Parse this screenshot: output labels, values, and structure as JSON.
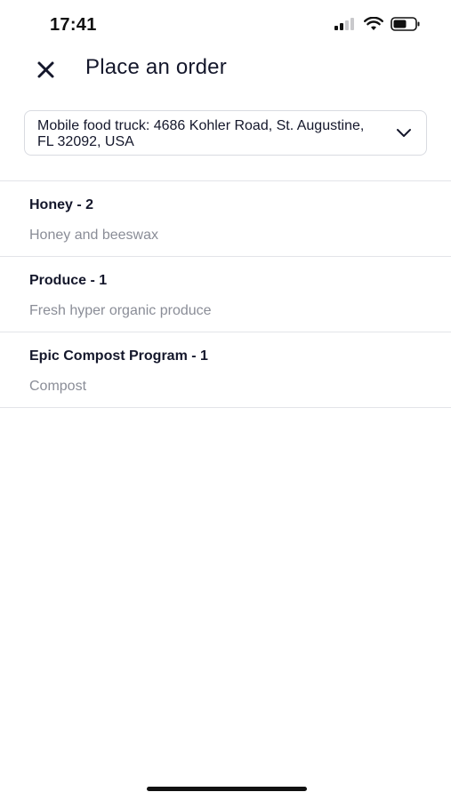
{
  "status_bar": {
    "time": "17:41",
    "icons": [
      "cellular-signal-icon",
      "wifi-icon",
      "battery-icon"
    ]
  },
  "header": {
    "title": "Place an order",
    "close_icon": "close-icon"
  },
  "location": {
    "value": "Mobile food truck: 4686 Kohler Road, St. Augustine, FL 32092, USA",
    "icon": "chevron-down-icon"
  },
  "products": [
    {
      "title": "Honey - 2",
      "description": "Honey and beeswax"
    },
    {
      "title": "Produce - 1",
      "description": "Fresh hyper organic produce"
    },
    {
      "title": "Epic Compost Program - 1",
      "description": "Compost"
    }
  ],
  "colors": {
    "text_primary": "#14172b",
    "text_secondary": "#8a8d97",
    "divider": "#e3e4e8",
    "background": "#ffffff"
  }
}
